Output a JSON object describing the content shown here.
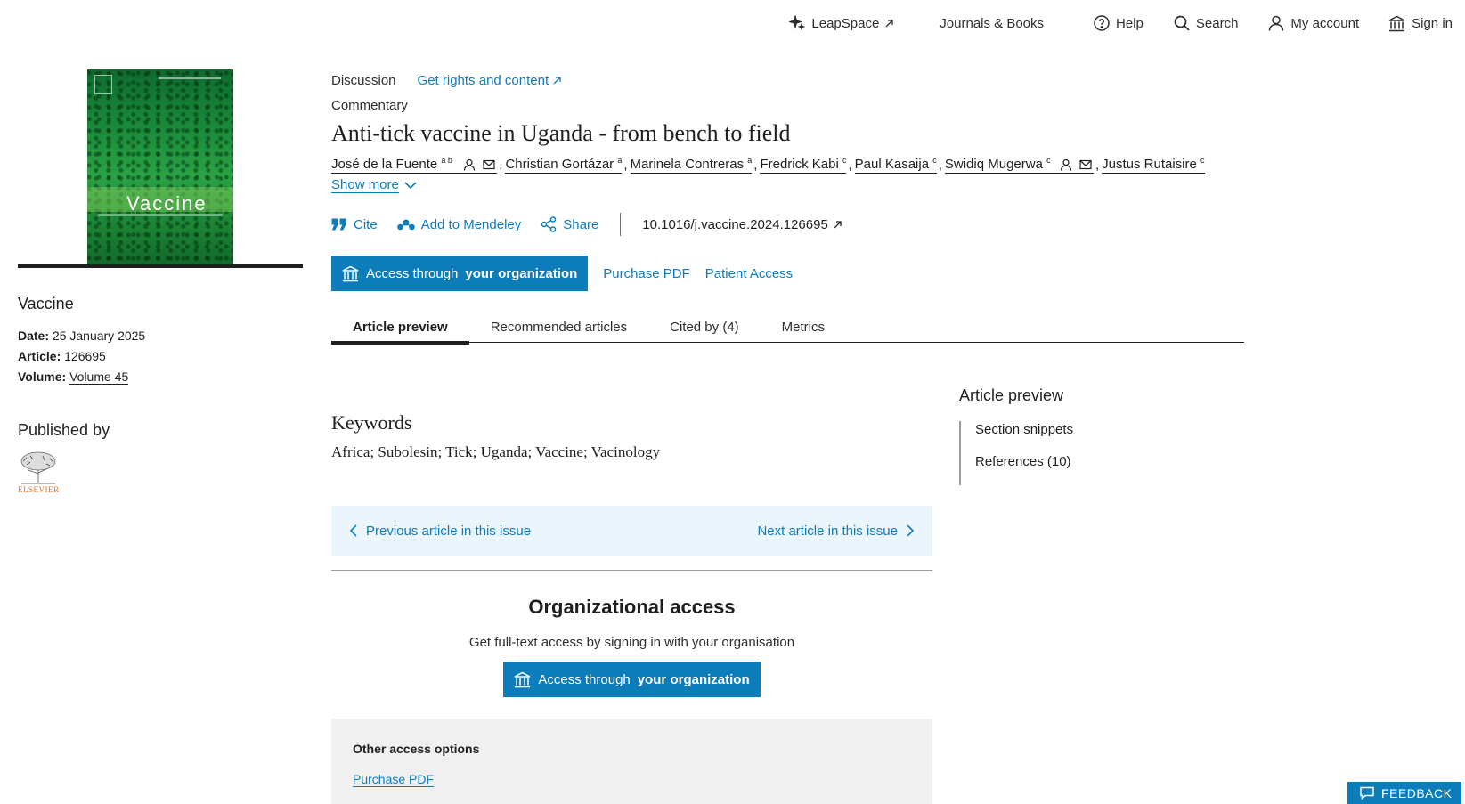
{
  "topnav": {
    "leapspace": "LeapSpace",
    "journals": "Journals & Books",
    "help": "Help",
    "search": "Search",
    "account": "My account",
    "signin": "Sign in"
  },
  "journal": {
    "cover_title": "Vaccine",
    "name": "Vaccine",
    "date_label": "Date:",
    "date": "25 January 2025",
    "article_label": "Article:",
    "article": "126695",
    "volume_label": "Volume:",
    "volume": "Volume 45",
    "published_by": "Published by",
    "publisher_logo_text": "ELSEVIER"
  },
  "article": {
    "type": "Discussion",
    "rights_link": "Get rights and content",
    "subtype": "Commentary",
    "title": "Anti-tick vaccine in Uganda - from bench to field",
    "authors": [
      {
        "name": "José de la Fuente",
        "sup": "a b"
      },
      {
        "name": "Christian Gortázar",
        "sup": "a"
      },
      {
        "name": "Marinela Contreras",
        "sup": "a"
      },
      {
        "name": "Fredrick Kabi",
        "sup": "c"
      },
      {
        "name": "Paul Kasaija",
        "sup": "c"
      },
      {
        "name": "Swidiq Mugerwa",
        "sup": "c"
      },
      {
        "name": "Justus Rutaisire",
        "sup": "c"
      }
    ],
    "show_more": "Show more",
    "doi": "10.1016/j.vaccine.2024.126695"
  },
  "actions": {
    "cite": "Cite",
    "mendeley": "Add to Mendeley",
    "share": "Share"
  },
  "access": {
    "btn_prefix": "Access through",
    "btn_bold": "your organization",
    "purchase": "Purchase PDF",
    "patient": "Patient Access"
  },
  "tabs": [
    "Article preview",
    "Recommended articles",
    "Cited by (4)",
    "Metrics"
  ],
  "keywords": {
    "heading": "Keywords",
    "list": "Africa; Subolesin; Tick; Uganda; Vaccine; Vacinology"
  },
  "issue_nav": {
    "prev": "Previous article in this issue",
    "next": "Next article in this issue"
  },
  "org_access": {
    "heading": "Organizational access",
    "text": "Get full-text access by signing in with your organisation",
    "other_heading": "Other access options",
    "other_link": "Purchase PDF"
  },
  "outline": {
    "heading": "Article preview",
    "items": [
      "Section snippets",
      "References (10)"
    ]
  },
  "feedback": "FEEDBACK",
  "colors": {
    "link": "#0c7dbb",
    "text": "#1f1f1f",
    "preview_bg": "#eaf6fc",
    "publisher": "#e9711c"
  }
}
